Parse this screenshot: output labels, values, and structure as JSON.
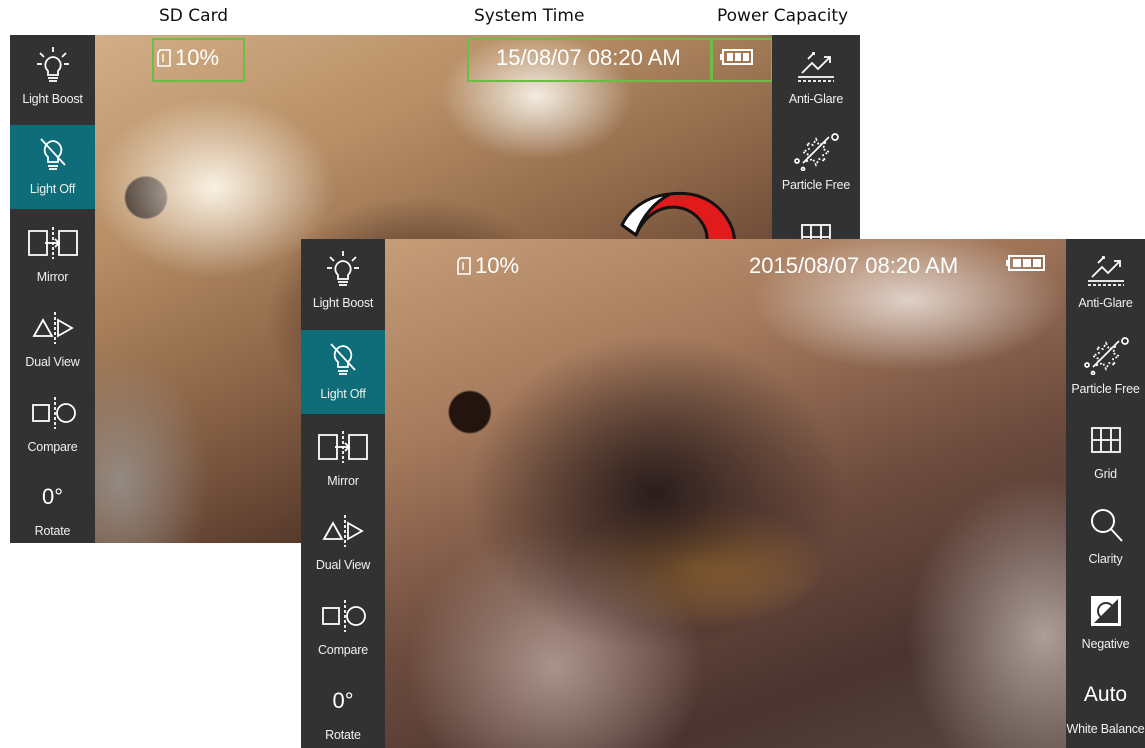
{
  "callouts": {
    "sd_card": "SD Card",
    "system_time": "System Time",
    "power_capacity": "Power Capacity"
  },
  "status": {
    "sd_card_percent": "10%",
    "datetime_full": "2015/08/07  08:20 AM",
    "datetime_cropped": "15/08/07  08:20 AM",
    "battery_icon": "battery-full-icon"
  },
  "left_tools": [
    {
      "label": "Light Boost",
      "icon": "bulb-rays-icon",
      "active": false
    },
    {
      "label": "Light Off",
      "icon": "bulb-off-icon",
      "active": true
    },
    {
      "label": "Mirror",
      "icon": "mirror-icon",
      "active": false
    },
    {
      "label": "Dual View",
      "icon": "dual-view-icon",
      "active": false
    },
    {
      "label": "Compare",
      "icon": "compare-icon",
      "active": false
    },
    {
      "label": "Rotate",
      "value": "0°",
      "active": false
    }
  ],
  "right_tools": [
    {
      "label": "Anti-Glare",
      "icon": "anti-glare-icon"
    },
    {
      "label": "Particle Free",
      "icon": "particle-free-icon"
    },
    {
      "label": "Grid",
      "icon": "grid-icon"
    },
    {
      "label": "Clarity",
      "icon": "magnifier-icon"
    },
    {
      "label": "Negative",
      "icon": "negative-icon"
    },
    {
      "label": "White Balance",
      "value": "Auto"
    }
  ],
  "colors": {
    "sidebar_bg": "#323232",
    "active_tool_bg": "#0e6d78",
    "highlight_box": "#6cbd45",
    "arrow_fill": "#e11b1b"
  }
}
